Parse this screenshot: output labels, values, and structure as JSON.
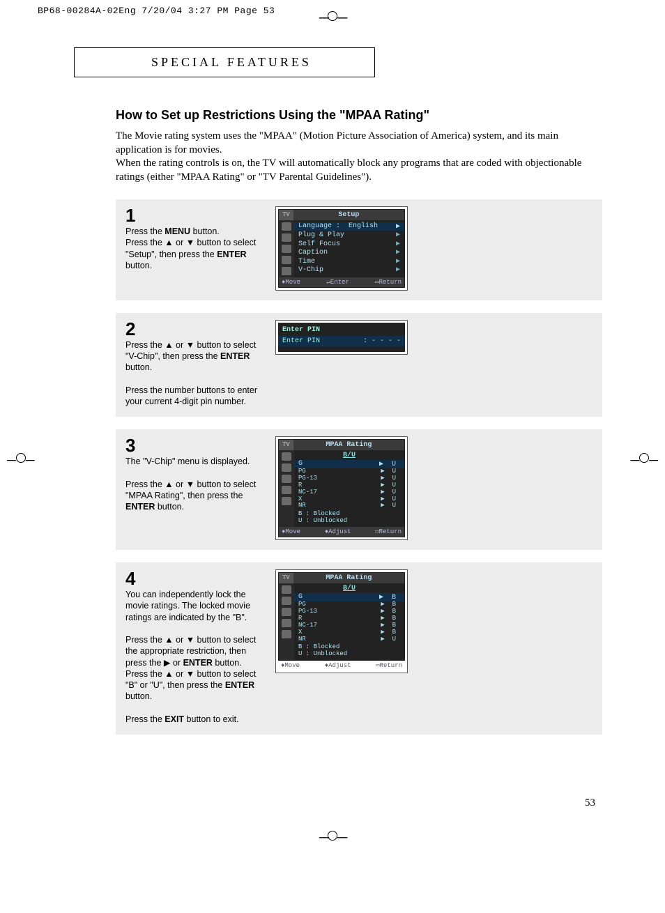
{
  "print_header": "BP68-00284A-02Eng  7/20/04  3:27 PM  Page 53",
  "section_header": "SPECIAL FEATURES",
  "title": "How to Set up Restrictions Using the \"MPAA Rating\"",
  "intro_line1": "The Movie rating system uses the \"MPAA\" (Motion Picture Association of America) system, and its main application is for movies.",
  "intro_line2": "When the rating controls is on, the TV will automatically block any programs that are coded with objectionable ratings (either \"MPAA Rating\" or \"TV Parental Guidelines\").",
  "step1": {
    "num": "1",
    "l1a": "Press the ",
    "l1b": "MENU",
    "l1c": " button.",
    "l2a": "Press the ▲ or ▼ button to select \"Setup\", then press the ",
    "l2b": "ENTER",
    "l2c": " button."
  },
  "osd1": {
    "tv": "TV",
    "title": "Setup",
    "r1a": "Language  :",
    "r1b": "English",
    "r2": "Plug & Play",
    "r3": "Self Focus",
    "r4": "Caption",
    "r5": "Time",
    "r6": "V-Chip",
    "f1": "Move",
    "f2": "Enter",
    "f3": "Return"
  },
  "step2": {
    "num": "2",
    "l1a": "Press the ▲ or ▼ button to select \"V-Chip\", then press the ",
    "l1b": "ENTER",
    "l1c": " button.",
    "l2": "Press the number buttons to enter your current 4-digit pin number."
  },
  "osd2": {
    "title": "Enter PIN",
    "label": "Enter PIN",
    "value": ": - - - -"
  },
  "step3": {
    "num": "3",
    "l1": "The \"V-Chip\" menu is displayed.",
    "l2a": "Press the ▲ or ▼ button to select \"MPAA Rating\", then press the ",
    "l2b": "ENTER",
    "l2c": " button."
  },
  "osd3": {
    "title": "MPAA Rating",
    "col": "B/U",
    "rows": [
      {
        "n": "G",
        "v": "U"
      },
      {
        "n": "PG",
        "v": "U"
      },
      {
        "n": "PG-13",
        "v": "U"
      },
      {
        "n": "R",
        "v": "U"
      },
      {
        "n": "NC-17",
        "v": "U"
      },
      {
        "n": "X",
        "v": "U"
      },
      {
        "n": "NR",
        "v": "U"
      }
    ],
    "leg1": "B : Blocked",
    "leg2": "U : Unblocked",
    "f1": "Move",
    "f2": "Adjust",
    "f3": "Return"
  },
  "step4": {
    "num": "4",
    "l1": "You can independently lock the movie ratings. The locked movie ratings are indicated by the \"B\".",
    "l2a": "Press the ▲ or ▼ button to select the appropriate restriction, then press  the ▶ or ",
    "l2b": "ENTER",
    "l2c": " button. Press the ▲ or ▼ button to select \"B\" or \"U\", then press the ",
    "l2d": "ENTER",
    "l2e": " button.",
    "l3a": "Press the ",
    "l3b": "EXIT",
    "l3c": " button to exit."
  },
  "osd4": {
    "title": "MPAA Rating",
    "col": "B/U",
    "rows": [
      {
        "n": "G",
        "v": "B"
      },
      {
        "n": "PG",
        "v": "B"
      },
      {
        "n": "PG-13",
        "v": "B"
      },
      {
        "n": "R",
        "v": "B"
      },
      {
        "n": "NC-17",
        "v": "B"
      },
      {
        "n": "X",
        "v": "B"
      },
      {
        "n": "NR",
        "v": "U"
      }
    ],
    "leg1": "B : Blocked",
    "leg2": "U : Unblocked",
    "f1": "Move",
    "f2": "Adjust",
    "f3": "Return"
  },
  "page_number": "53",
  "sym": {
    "tri": "▶",
    "ud": "◆",
    "lr": "◆",
    "enter": "↵",
    "menu": "▭"
  }
}
